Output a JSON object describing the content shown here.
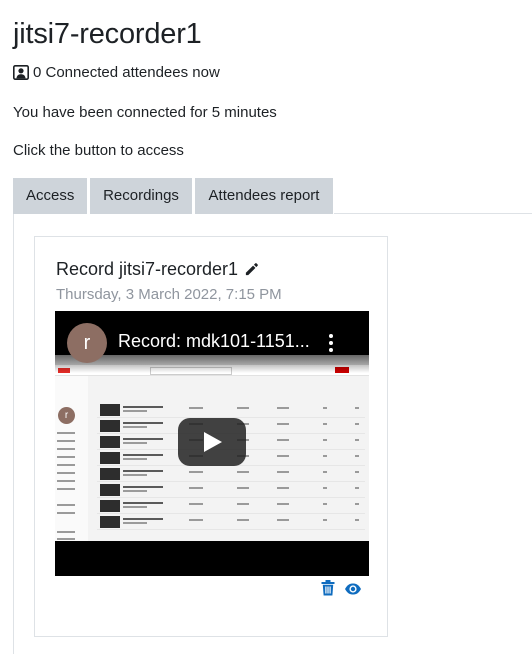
{
  "page": {
    "title": "jitsi7-recorder1",
    "attendees_now": "0 Connected attendees now",
    "connected_for": "You have been connected for 5 minutes",
    "access_hint": "Click the button to access"
  },
  "tabs": [
    {
      "label": "Access",
      "icon": "none"
    },
    {
      "label": "Recordings",
      "icon": "none"
    },
    {
      "label": "Attendees report",
      "icon": "none"
    }
  ],
  "recording": {
    "title": "Record jitsi7-recorder1",
    "date": "Thursday, 3 March 2022, 7:15 PM",
    "video": {
      "title": "Record: mdk101-1151...",
      "channel_initial": "r"
    },
    "actions": {
      "delete_icon": "trash-icon",
      "view_icon": "eye-icon"
    }
  },
  "colors": {
    "tab_bg": "#ced4da",
    "action_blue": "#0f6cbf",
    "muted_text": "#8f959e",
    "avatar": "#8d6e63"
  }
}
